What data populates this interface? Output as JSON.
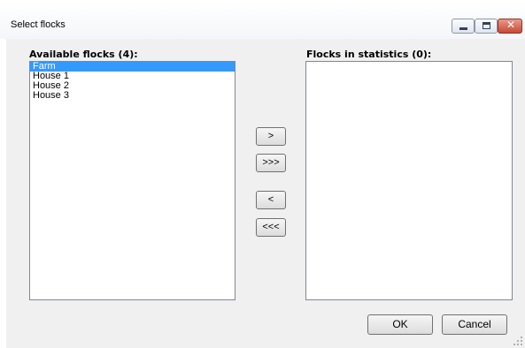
{
  "window": {
    "title": "Select flocks",
    "controls": {
      "minimize": "minimize-icon",
      "maximize": "maximize-icon",
      "close": "close-icon"
    },
    "colors": {
      "close_button": "#c74a35",
      "selection": "#3399ff",
      "dialog_bg": "#f0f0f0"
    }
  },
  "available": {
    "label": "Available flocks (4):",
    "items": [
      "Farm",
      "House 1",
      "House 2",
      "House 3"
    ],
    "selected_index": 0
  },
  "statistics": {
    "label": "Flocks in statistics (0):",
    "items": []
  },
  "transfer": {
    "add_one": ">",
    "add_all": ">>>",
    "remove_one": "<",
    "remove_all": "<<<"
  },
  "dialog": {
    "ok": "OK",
    "cancel": "Cancel"
  }
}
